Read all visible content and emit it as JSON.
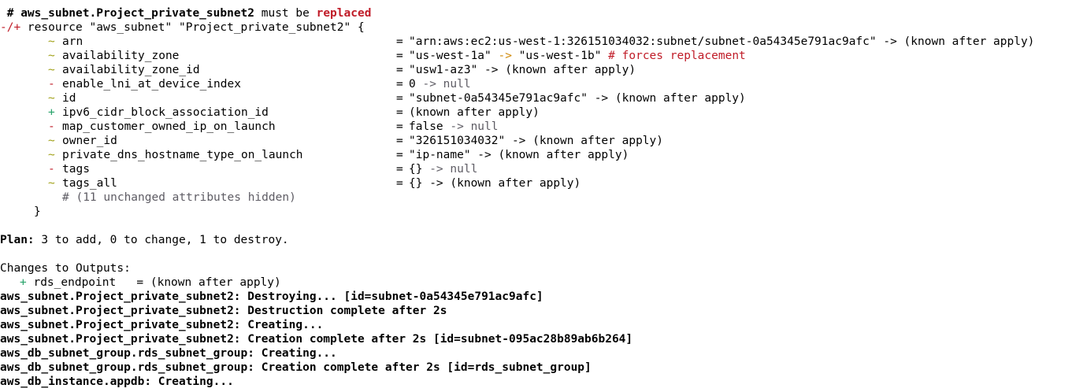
{
  "header": {
    "prefix": " # ",
    "resource": "aws_subnet.Project_private_subnet2",
    "middle": " must be ",
    "action": "replaced"
  },
  "resource_open": {
    "symbol": "-/+",
    "text": " resource \"aws_subnet\" \"Project_private_subnet2\" {"
  },
  "attributes": [
    {
      "sym": "~",
      "name": "arn",
      "eq": "=",
      "value": "\"arn:aws:ec2:us-west-1:326151034032:subnet/subnet-0a54345e791ac9afc\" -> (known after apply)"
    },
    {
      "sym": "~",
      "name": "availability_zone",
      "eq": "=",
      "v1": "\"us-west-1a\"",
      "arrow": " -> ",
      "v2": "\"us-west-1b\"",
      "comment": " # forces replacement"
    },
    {
      "sym": "~",
      "name": "availability_zone_id",
      "eq": "=",
      "value": "\"usw1-az3\" -> (known after apply)"
    },
    {
      "sym": "-",
      "name": "enable_lni_at_device_index",
      "eq": "=",
      "v1": "0",
      "tail": " -> null"
    },
    {
      "sym": "~",
      "name": "id",
      "eq": "=",
      "value": "\"subnet-0a54345e791ac9afc\" -> (known after apply)"
    },
    {
      "sym": "+",
      "name": "ipv6_cidr_block_association_id",
      "eq": "=",
      "value": "(known after apply)"
    },
    {
      "sym": "-",
      "name": "map_customer_owned_ip_on_launch",
      "eq": "=",
      "v1": "false",
      "tail": " -> null"
    },
    {
      "sym": "~",
      "name": "owner_id",
      "eq": "=",
      "value": "\"326151034032\" -> (known after apply)"
    },
    {
      "sym": "~",
      "name": "private_dns_hostname_type_on_launch",
      "eq": "=",
      "value": "\"ip-name\" -> (known after apply)"
    },
    {
      "sym": "-",
      "name": "tags",
      "eq": "=",
      "v1": "{}",
      "tail": " -> null"
    },
    {
      "sym": "~",
      "name": "tags_all",
      "eq": "=",
      "value": "{} -> (known after apply)"
    }
  ],
  "hidden_note": "# (11 unchanged attributes hidden)",
  "close_brace": "}",
  "plan": {
    "label": "Plan:",
    "text": " 3 to add, 0 to change, 1 to destroy."
  },
  "outputs": {
    "heading": "Changes to Outputs:",
    "sym": "+",
    "text": " rds_endpoint   = (known after apply)"
  },
  "log": [
    "aws_subnet.Project_private_subnet2: Destroying... [id=subnet-0a54345e791ac9afc]",
    "aws_subnet.Project_private_subnet2: Destruction complete after 2s",
    "aws_subnet.Project_private_subnet2: Creating...",
    "aws_subnet.Project_private_subnet2: Creation complete after 2s [id=subnet-095ac28b89ab6b264]",
    "aws_db_subnet_group.rds_subnet_group: Creating...",
    "aws_db_subnet_group.rds_subnet_group: Creation complete after 2s [id=rds_subnet_group]",
    "aws_db_instance.appdb: Creating..."
  ],
  "colors": {
    "background": "#ffffff",
    "text": "#000000",
    "replace_red": "#c01c28",
    "change_olive": "#a2a21a",
    "add_green": "#26a269",
    "muted_grey": "#5e5c64"
  }
}
